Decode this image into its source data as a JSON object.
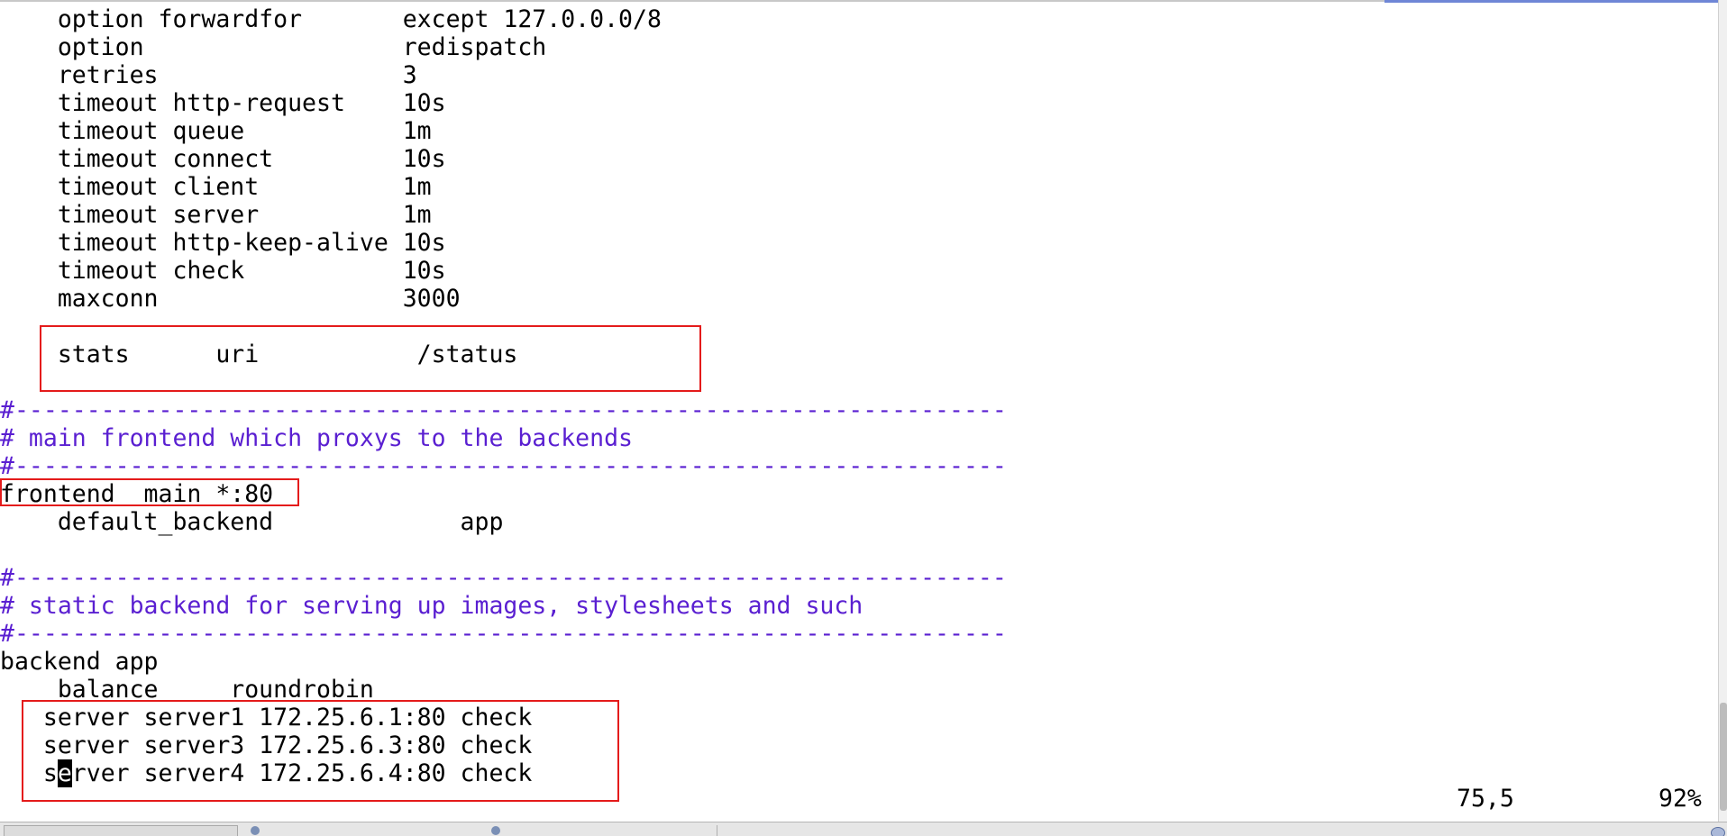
{
  "editor": {
    "lines": [
      {
        "type": "code",
        "parts": [
          {
            "text": "    option forwardfor       except 127.0.0.0/8"
          }
        ]
      },
      {
        "type": "code",
        "parts": [
          {
            "text": "    option                  redispatch"
          }
        ]
      },
      {
        "type": "code",
        "parts": [
          {
            "text": "    retries                 3"
          }
        ]
      },
      {
        "type": "code",
        "parts": [
          {
            "text": "    timeout http-request    10s"
          }
        ]
      },
      {
        "type": "code",
        "parts": [
          {
            "text": "    timeout queue           1m"
          }
        ]
      },
      {
        "type": "code",
        "parts": [
          {
            "text": "    timeout connect         10s"
          }
        ]
      },
      {
        "type": "code",
        "parts": [
          {
            "text": "    timeout client          1m"
          }
        ]
      },
      {
        "type": "code",
        "parts": [
          {
            "text": "    timeout server          1m"
          }
        ]
      },
      {
        "type": "code",
        "parts": [
          {
            "text": "    timeout http-keep-alive 10s"
          }
        ]
      },
      {
        "type": "code",
        "parts": [
          {
            "text": "    timeout check           10s"
          }
        ]
      },
      {
        "type": "code",
        "parts": [
          {
            "text": "    maxconn                 3000"
          }
        ]
      },
      {
        "type": "code",
        "parts": [
          {
            "text": ""
          }
        ]
      },
      {
        "type": "code",
        "parts": [
          {
            "text": "    stats      uri           /status"
          }
        ]
      },
      {
        "type": "code",
        "parts": [
          {
            "text": ""
          }
        ]
      },
      {
        "type": "comment",
        "parts": [
          {
            "text": "#---------------------------------------------------------------------"
          }
        ]
      },
      {
        "type": "comment",
        "parts": [
          {
            "text": "# main frontend which proxys to the backends"
          }
        ]
      },
      {
        "type": "comment",
        "parts": [
          {
            "text": "#---------------------------------------------------------------------"
          }
        ]
      },
      {
        "type": "code",
        "parts": [
          {
            "text": "frontend  main *:80"
          }
        ]
      },
      {
        "type": "code",
        "parts": [
          {
            "text": "    default_backend             app"
          }
        ]
      },
      {
        "type": "code",
        "parts": [
          {
            "text": ""
          }
        ]
      },
      {
        "type": "comment",
        "parts": [
          {
            "text": "#---------------------------------------------------------------------"
          }
        ]
      },
      {
        "type": "comment",
        "parts": [
          {
            "text": "# static backend for serving up images, stylesheets and such"
          }
        ]
      },
      {
        "type": "comment",
        "parts": [
          {
            "text": "#---------------------------------------------------------------------"
          }
        ]
      },
      {
        "type": "code",
        "parts": [
          {
            "text": "backend app"
          }
        ]
      },
      {
        "type": "code",
        "parts": [
          {
            "text": "    balance     roundrobin"
          }
        ]
      },
      {
        "type": "code",
        "parts": [
          {
            "text": "   server server1 172.25.6.1:80 check"
          }
        ]
      },
      {
        "type": "code",
        "parts": [
          {
            "text": "   server server3 172.25.6.3:80 check"
          }
        ]
      },
      {
        "type": "code",
        "parts": [
          {
            "text": "   s"
          },
          {
            "text": "e",
            "cursor": true
          },
          {
            "text": "rver server4 172.25.6.4:80 check"
          }
        ]
      }
    ]
  },
  "status": {
    "ruler": "75,5",
    "percent": "92%"
  },
  "colors": {
    "comment": "#5a1fd1",
    "highlight_box": "#e41b1b",
    "text": "#000000",
    "background": "#ffffff"
  }
}
